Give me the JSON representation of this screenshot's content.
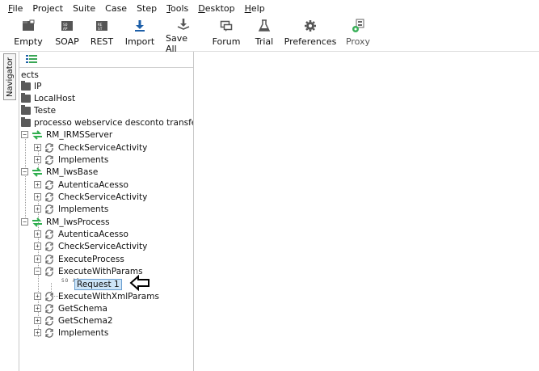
{
  "menu": [
    {
      "label": "File",
      "mn": "F",
      "rest": "ile"
    },
    {
      "label": "Project",
      "mn": "",
      "rest": "Project"
    },
    {
      "label": "Suite",
      "mn": "",
      "rest": "Suite"
    },
    {
      "label": "Case",
      "mn": "",
      "rest": "Case"
    },
    {
      "label": "Step",
      "mn": "",
      "rest": "Step"
    },
    {
      "label": "Tools",
      "mn": "T",
      "rest": "ools"
    },
    {
      "label": "Desktop",
      "mn": "D",
      "rest": "esktop"
    },
    {
      "label": "Help",
      "mn": "H",
      "rest": "elp"
    }
  ],
  "toolbar": {
    "empty": "Empty",
    "soap": "SOAP",
    "rest": "REST",
    "import": "Import",
    "save_all": "Save All",
    "forum": "Forum",
    "trial": "Trial",
    "preferences": "Preferences",
    "proxy": "Proxy"
  },
  "navigator": {
    "tab_label": "Navigator",
    "root_label": "ects",
    "projects": [
      "IP",
      "LocalHost",
      "Teste",
      "processo webservice desconto transferencia"
    ],
    "interfaces": [
      {
        "name": "RM_IRMSServer",
        "operations": [
          "CheckServiceActivity",
          "Implements"
        ]
      },
      {
        "name": "RM_IwsBase",
        "operations": [
          "AutenticaAcesso",
          "CheckServiceActivity",
          "Implements"
        ]
      },
      {
        "name": "RM_IwsProcess",
        "operations": [
          "AutenticaAcesso",
          "CheckServiceActivity",
          "ExecuteProcess",
          "ExecuteWithParams",
          "ExecuteWithXmlParams",
          "GetSchema",
          "GetSchema2",
          "Implements"
        ]
      }
    ],
    "request_icon": "SO AP",
    "selected_request": "Request 1"
  },
  "colors": {
    "interface_green": "#2fae4e",
    "selection_bg": "#cde4f7",
    "selection_border": "#6a9fd0",
    "folder_gray": "#5a5a5a"
  }
}
